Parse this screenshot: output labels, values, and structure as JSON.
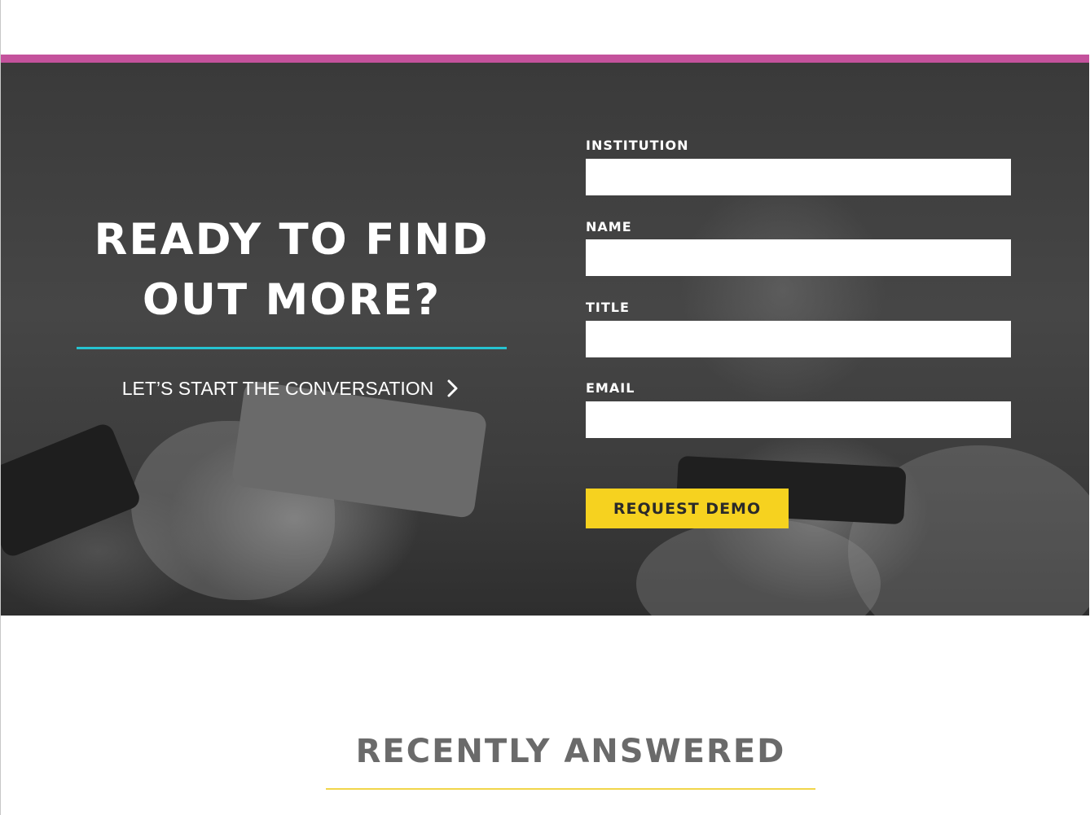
{
  "colors": {
    "accent_bar": "#c4529c",
    "divider": "#26c3d1",
    "button_bg": "#f6d21f",
    "section_divider": "#f1d54a",
    "section_title": "#6a6a6a"
  },
  "hero": {
    "heading": "READY TO FIND OUT MORE?",
    "cta_label": "LET’S START THE CONVERSATION",
    "cta_icon": "chevron-right-icon"
  },
  "form": {
    "fields": [
      {
        "label": "INSTITUTION",
        "value": "",
        "placeholder": ""
      },
      {
        "label": "NAME",
        "value": "",
        "placeholder": ""
      },
      {
        "label": "TITLE",
        "value": "",
        "placeholder": ""
      },
      {
        "label": "EMAIL",
        "value": "",
        "placeholder": ""
      }
    ],
    "submit_label": "REQUEST DEMO"
  },
  "recent": {
    "title": "RECENTLY ANSWERED"
  }
}
